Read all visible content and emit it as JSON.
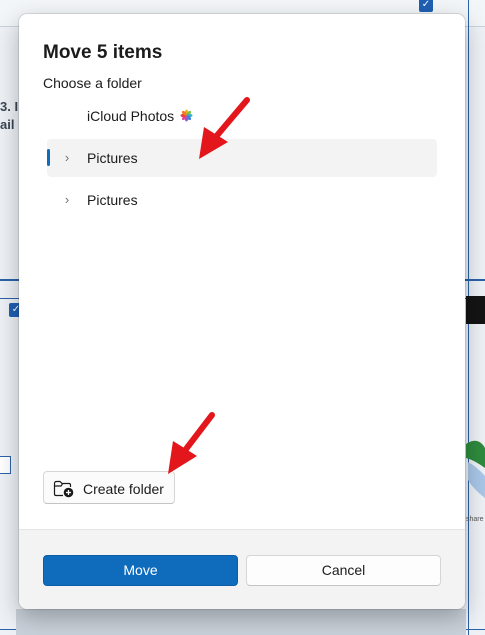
{
  "dialog": {
    "title": "Move 5 items",
    "subtitle": "Choose a folder",
    "folders": [
      {
        "label": "iCloud Photos",
        "icon": "icloud-photos-icon",
        "has_chevron": false,
        "selected": false
      },
      {
        "label": "Pictures",
        "icon": "chevron-right-icon",
        "has_chevron": true,
        "selected": true
      },
      {
        "label": "Pictures",
        "icon": "chevron-right-icon",
        "has_chevron": true,
        "selected": false
      }
    ],
    "create_folder_label": "Create folder",
    "move_label": "Move",
    "cancel_label": "Cancel"
  },
  "background": {
    "partial_text_line1": "3. I",
    "partial_text_line2": "ail",
    "partial_small_text": "share"
  },
  "colors": {
    "accent": "#0f6cbd",
    "annotation_arrow": "#e3161b"
  }
}
